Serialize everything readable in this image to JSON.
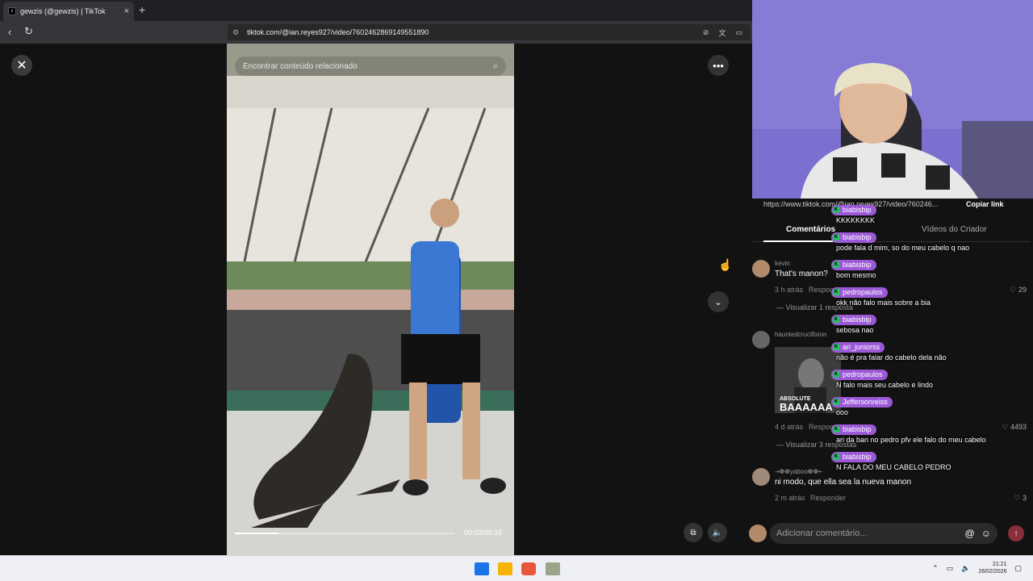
{
  "browser": {
    "tab_title": "gewzis (@gewzis) | TikTok",
    "tab_favicon_icon": "tiktok-icon",
    "new_tab_label": "+",
    "close_tab_label": "×",
    "url": "tiktok.com/@ian.reyes927/video/7602462869149551890"
  },
  "video": {
    "search_placeholder": "Encontrar conteúdo relacionado",
    "time": "00:03/00:15",
    "progress": 0.2
  },
  "panel": {
    "share_url": "https://www.tiktok.com/@ian.reyes927/video/760246...",
    "copy_link_label": "Copiar link",
    "tabs": [
      "Comentários",
      "Vídeos do Criador"
    ],
    "comments": [
      {
        "user": "kevin",
        "text": "That's manon?",
        "time": "3 h atrás",
        "reply": "Responder",
        "likes": "29",
        "view_replies": "Visualizar 1 resposta"
      },
      {
        "user": "hauntedcrucifixion",
        "text": "",
        "gif_caption": "ABSOLUTE",
        "gif_big": "BAAAAAA",
        "time": "4 d atrás",
        "reply": "Responder",
        "likes": "4493",
        "view_replies": "Visualizar 3 respostas"
      },
      {
        "user": "-•❁❁yaboo❁❁•-",
        "text": "ni modo, que ella sea la nueva manon",
        "time": "2 m atrás",
        "reply": "Responder",
        "likes": "3"
      }
    ],
    "input_placeholder": "Adicionar comentário..."
  },
  "chat": [
    {
      "user": "biabisbip",
      "text": "KKKKKKKK"
    },
    {
      "user": "biabisbip",
      "text": "pode fala d mim, so do meu cabelo q nao"
    },
    {
      "user": "biabisbip",
      "text": "bom mesmo"
    },
    {
      "user": "pedropaulos",
      "text": "okk não falo mais sobre a bia"
    },
    {
      "user": "biabisbip",
      "text": "sebosa nao"
    },
    {
      "user": "ari_juniorss",
      "text": "não é pra falar do cabelo dela não"
    },
    {
      "user": "pedropaulos",
      "text": "N falo mais seu cabelo e lindo"
    },
    {
      "user": "Jeffersonreiss",
      "text": "ooo"
    },
    {
      "user": "biabisbip",
      "text": "ari da ban no pedro pfv ele falo do meu cabelo"
    },
    {
      "user": "biabisbip",
      "text": "N FALA DO MEU CABELO PEDRO"
    }
  ],
  "taskbar": {
    "time": "21:21",
    "date": "26/02/2026"
  },
  "colors": {
    "chat_badge": "#9b59d6",
    "send_button": "#8a2f3a",
    "background": "#121212"
  }
}
